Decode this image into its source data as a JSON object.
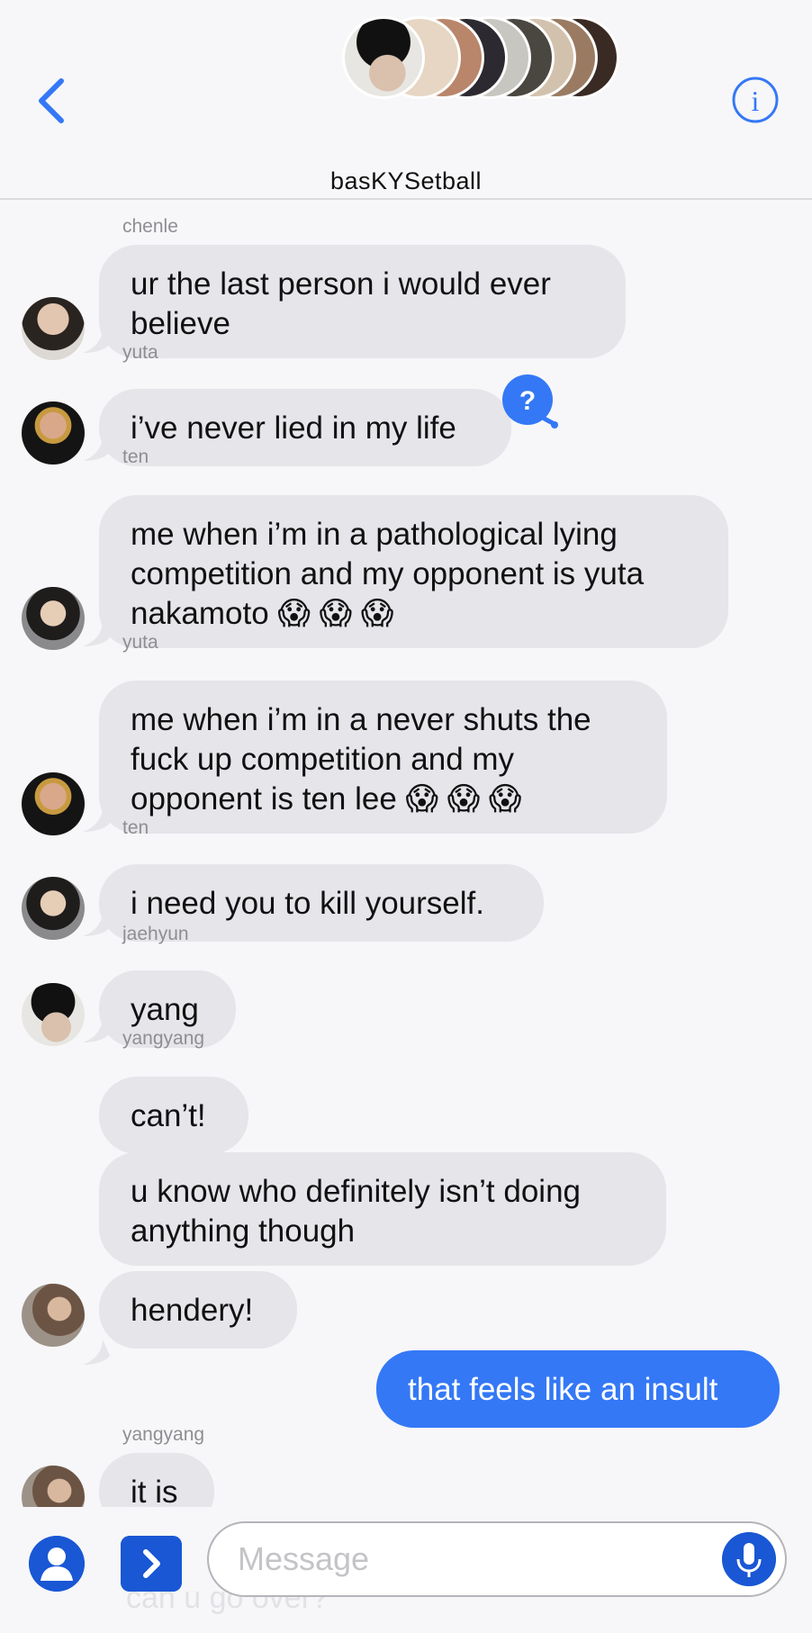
{
  "header": {
    "back_icon": "chevron-left-icon",
    "info_icon": "info-icon",
    "group_name": "basKYSetball",
    "accent": "#3478f6"
  },
  "messages": [
    {
      "sender": "chenle",
      "text": "ur the last person i would ever believe",
      "avatar": "avatar-chenle"
    },
    {
      "sender": "yuta",
      "text": "i’ve never lied in my life",
      "avatar": "avatar-yuta"
    },
    {
      "sender": "ten",
      "text": "me when i’m in a pathological lying competition and my opponent is yuta nakamoto 😱 😱 😱",
      "avatar": "avatar-ten"
    },
    {
      "sender": "yuta",
      "text": "me when i’m in a never shuts the fuck up competition and my opponent is ten lee 😱 😱 😱",
      "avatar": "avatar-yuta"
    },
    {
      "sender": "ten",
      "text": "i need you to kill yourself.",
      "avatar": "avatar-ten"
    },
    {
      "sender": "jaehyun",
      "text": "yang",
      "avatar": "avatar-jaehyun"
    },
    {
      "sender": "yangyang",
      "text": "can’t!"
    },
    {
      "text": "u know who definitely isn’t doing anything though"
    },
    {
      "text": "hendery!",
      "avatar": "avatar-yangyang"
    },
    {
      "from_me": true,
      "text": "that feels like an insult"
    },
    {
      "sender": "yangyang",
      "text": "it is",
      "avatar": "avatar-yangyang"
    }
  ],
  "help_badge": "?",
  "composer": {
    "placeholder": "Message",
    "contact_icon": "person-icon",
    "apps_icon": "chevron-right-icon",
    "mic_icon": "microphone-icon",
    "under_text": "can u go over?"
  }
}
